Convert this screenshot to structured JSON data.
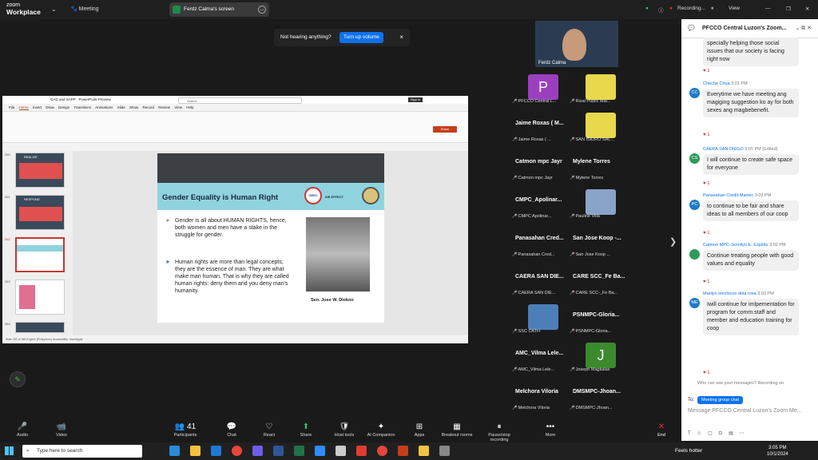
{
  "top": {
    "app_line1": "zoom",
    "app_line2": "Workplace",
    "meeting": "Meeting",
    "share_label": "Ferdz Calma's screen",
    "recording": "Recording...",
    "view": "View"
  },
  "notice": {
    "text": "Not hearing anything?",
    "button": "Turn up volume",
    "close": "×"
  },
  "ppt": {
    "file": "GAD and SAPP",
    "preview": "PowerPoint Preview",
    "search": "Search",
    "signin": "Sign in",
    "menu": [
      "File",
      "Home",
      "Insert",
      "Draw",
      "Design",
      "Transitions",
      "Animations",
      "Slide Show",
      "Record",
      "Review",
      "View",
      "Help"
    ],
    "share": "Share",
    "thumb_nums": [
      "260",
      "261",
      "262",
      "263",
      "264"
    ],
    "thumb_titles": [
      "REALIZE",
      "RESPOND"
    ],
    "status": "Slide 262 of 268   English (Philippines)   Accessibility: Investigate",
    "slide": {
      "title": "Gender Equality is Human Right",
      "bullet1": "Gender is all about HUMAN RIGHTS, hence, both women and men have a stake in the struggle for gender.",
      "bullet2": "Human rights are more than legal concepts; they are the essence of man. They are what make man human. That is why they are called human rights: deny them and you deny man's humanity.",
      "caption": "Sen. Jose W. Diokno",
      "logo_text": "GEEC",
      "we_effect": "WE EFFECT"
    }
  },
  "selfview": {
    "name": "Ferdz Calma"
  },
  "gallery": [
    {
      "big": "P",
      "name": "PFCCO Central L...",
      "avatar": true,
      "color": "#9c3fbf"
    },
    {
      "big": "",
      "name": "Rizal Public Mar...",
      "avatar": true,
      "color": "#e8d84c"
    },
    {
      "big": "Jaime Roxas ( M...",
      "name": "Jaime Roxas ( ..."
    },
    {
      "big": "",
      "name": "SAN ISIDRO SAL...",
      "avatar": true,
      "color": "#e8d84c"
    },
    {
      "big": "Catmon mpc Jayr",
      "name": "Catmon mpc Jayr"
    },
    {
      "big": "Mylene Torres",
      "name": "Mylene Torres"
    },
    {
      "big": "CMPC_Apolinar...",
      "name": "CMPC Apolinar..."
    },
    {
      "big": "",
      "name": "Pauline Villa",
      "avatar": true,
      "color": "#8aa4c8"
    },
    {
      "big": "Panasahan Cred...",
      "name": "Panasahan Cred..."
    },
    {
      "big": "San Jose Koop -...",
      "name": "San Jose Koop ..."
    },
    {
      "big": "CAERA SAN DIE...",
      "name": "CAERA SAN DIE..."
    },
    {
      "big": "CARE SCC_Fe Ba...",
      "name": "CARE SCC-_Fe Ba..."
    },
    {
      "big": "",
      "name": "SSC CATH",
      "avatar": true,
      "color": "#4c7fb8"
    },
    {
      "big": "PSNMPC-Gloria...",
      "name": "PSNMPC-Gloria..."
    },
    {
      "big": "AMC_Vilma Lele...",
      "name": "AMC_Vilma Lele..."
    },
    {
      "big": "J",
      "name": "Joseph Magkalas",
      "avatar": true,
      "color": "#3b8a2e"
    },
    {
      "big": "Melchora Viloria",
      "name": "Melchora Viloria"
    },
    {
      "big": "DMSMPC-Jhoan...",
      "name": "DMSMPC-Jhoan..."
    }
  ],
  "chat": {
    "title": "PFCCO Central Luzon's Zoom...",
    "messages": [
      {
        "who": "",
        "time": "",
        "initials": "",
        "text": "specially helping those social issues that our society is facing right now",
        "react": "♥ 1"
      },
      {
        "who": "Cheche Chua",
        "time": "3:01 PM",
        "initials": "CC",
        "text": "Everytime we have meeting ang magiging suggestion ko ay for both sexes ang magbebenefit.",
        "react": "♥ 1"
      },
      {
        "who": "CAERA SAN DIEGO",
        "time": "3:01 PM (Edited)",
        "initials": "CS",
        "text": "I will continue to create safe space for everyone",
        "react": "♥ 1"
      },
      {
        "who": "Panasahan Credit-Marivic",
        "time": "3:02 PM",
        "initials": "PC",
        "text": "to continue to be fair and share ideas to all members of our coop",
        "react": "♥ 1"
      },
      {
        "who": "Catmon MPC-Jennilyn E. Espiritu",
        "time": "3:02 PM",
        "initials": "",
        "text": "Continue treating people with good values and equality",
        "react": "♥ 1"
      },
      {
        "who": "Marilyn elechicon dela rosa",
        "time": "3:03 PM",
        "initials": "ME",
        "text": "Iwill continue for imlpementation for program for comm.staff and member and education training for coop",
        "react": "♥ 1"
      }
    ],
    "who_see": "Who can see your messages? Recording on",
    "to": "To:",
    "to_target": "Meeting group chat",
    "placeholder": "Message PFCCO Central Luzon's Zoom Me..."
  },
  "toolbar": [
    {
      "label": "Audio",
      "icon": "🎤"
    },
    {
      "label": "Video",
      "icon": "📹"
    },
    {
      "label": "Participants",
      "icon": "👥 41"
    },
    {
      "label": "Chat",
      "icon": "💬"
    },
    {
      "label": "React",
      "icon": "♡"
    },
    {
      "label": "Share",
      "icon": "⬆"
    },
    {
      "label": "Host tools",
      "icon": "🛡"
    },
    {
      "label": "AI Companion",
      "icon": "✦"
    },
    {
      "label": "Apps",
      "icon": "⊞"
    },
    {
      "label": "Breakout rooms",
      "icon": "▦"
    },
    {
      "label": "Pause/stop recording",
      "icon": "⏸"
    },
    {
      "label": "More",
      "icon": "•••"
    },
    {
      "label": "End",
      "icon": "✕"
    }
  ],
  "taskbar": {
    "search": "Type here to search",
    "weather": "Feels hotter",
    "time": "3:05 PM",
    "date": "10/1/2024"
  }
}
